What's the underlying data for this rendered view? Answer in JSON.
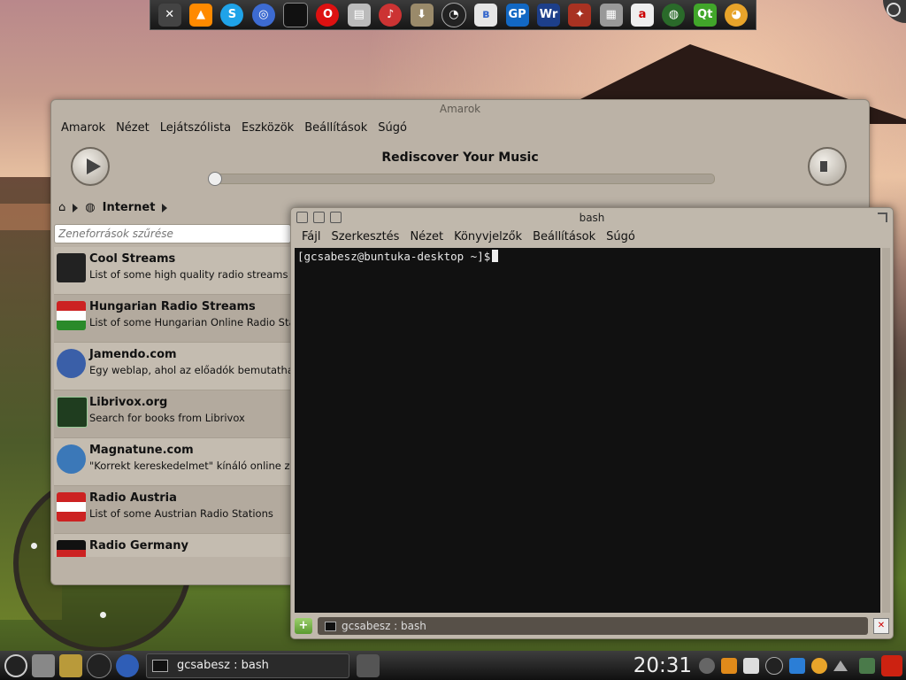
{
  "top_dock": {
    "icons": [
      "tools-icon",
      "vlc-icon",
      "skype-icon",
      "browser-icon",
      "terminal-icon",
      "opera-icon",
      "archive-icon",
      "media-icon",
      "installer-icon",
      "gauge-icon",
      "bluetooth-icon",
      "gp-icon",
      "writer-icon",
      "bird-icon",
      "calculator-icon",
      "dictionary-icon",
      "globe-icon",
      "qt-icon",
      "gimp-icon"
    ],
    "labels": {
      "gp": "GP",
      "writer": "Wr",
      "qt": "Qt"
    }
  },
  "amarok": {
    "title": "Amarok",
    "menu": [
      "Amarok",
      "Nézet",
      "Lejátszólista",
      "Eszközök",
      "Beállítások",
      "Súgó"
    ],
    "now_playing": "Rediscover Your Music",
    "progress_fraction": 0.0,
    "breadcrumb": "Internet",
    "filter_placeholder": "Zeneforrások szűrése",
    "services": [
      {
        "name": "Cool Streams",
        "desc": "List of some high quality radio streams",
        "icon": "music-note-icon",
        "color": "#222222"
      },
      {
        "name": "Hungarian Radio Streams",
        "desc": "List of some Hungarian Online Radio Stations",
        "icon": "hungary-flag-icon",
        "color": "#cc2222"
      },
      {
        "name": "Jamendo.com",
        "desc": "Egy weblap, ahol az előadók bemutathatják az alkot",
        "icon": "jamendo-icon",
        "color": "#3a5fa8"
      },
      {
        "name": "Librivox.org",
        "desc": "Search for books from Librivox",
        "icon": "librivox-icon",
        "color": "#1f3d1f"
      },
      {
        "name": "Magnatune.com",
        "desc": "\"Korrekt kereskedelmet\" kínáló online zeneáruház",
        "icon": "magnatune-icon",
        "color": "#3b78b8"
      },
      {
        "name": "Radio Austria",
        "desc": "List of some Austrian Radio Stations",
        "icon": "austria-flag-icon",
        "color": "#cc2222"
      },
      {
        "name": "Radio Germany",
        "desc": "",
        "icon": "germany-flag-icon",
        "color": "#bb2222"
      }
    ]
  },
  "konsole": {
    "title": "bash",
    "menu": [
      "Fájl",
      "Szerkesztés",
      "Nézet",
      "Könyvjelzők",
      "Beállítások",
      "Súgó"
    ],
    "prompt": "[gcsabesz@buntuka-desktop ~]$",
    "tab_label": "gcsabesz : bash"
  },
  "panel": {
    "task_label": "gcsabesz : bash",
    "clock": "20:31"
  }
}
